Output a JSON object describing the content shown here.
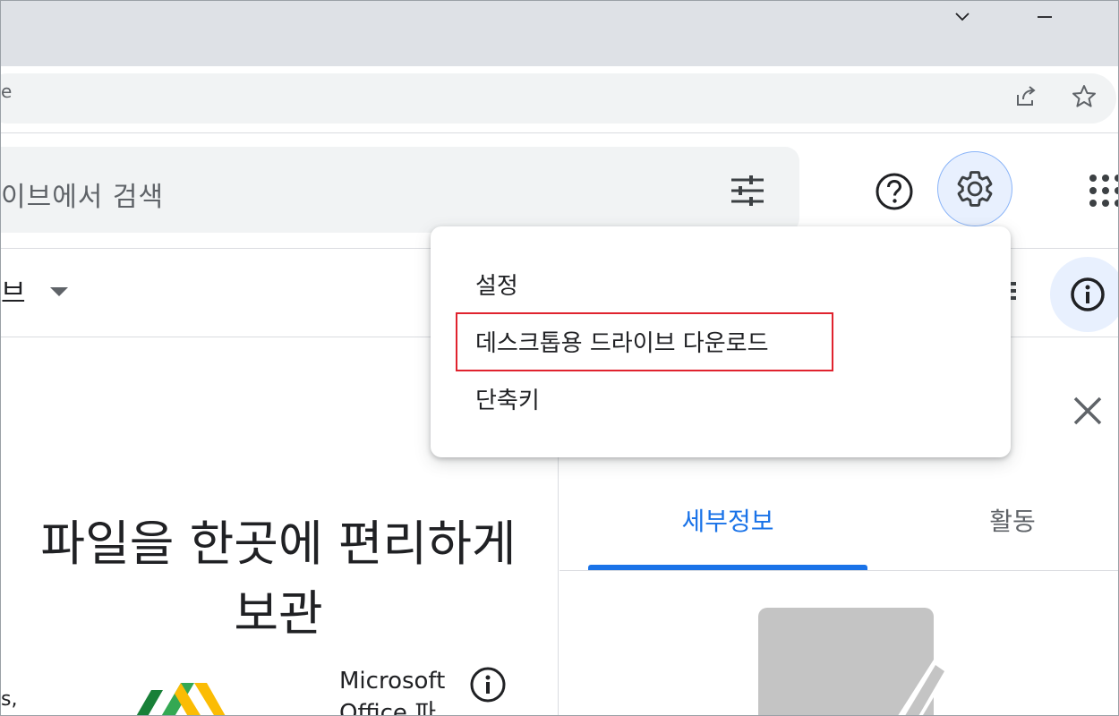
{
  "browser": {
    "omnibox_fragment": "e",
    "icons": [
      "chevron-down-icon",
      "minimize-icon",
      "share-icon",
      "star-icon"
    ]
  },
  "drive": {
    "search_placeholder": "이브에서 검색",
    "drive_label": "브",
    "icons": [
      "tune-icon",
      "help-icon",
      "gear-icon",
      "apps-grid-icon",
      "info-icon",
      "close-icon"
    ]
  },
  "settings_menu": {
    "items": [
      {
        "label": "설정"
      },
      {
        "label": "데스크톱용 드라이브 다운로드",
        "highlighted": true
      },
      {
        "label": "단축키"
      }
    ],
    "highlight_color": "#e0232e"
  },
  "main": {
    "hero_title_line1": "파일을 한곳에 편리하게",
    "hero_title_line2": "보관",
    "left_snippet": "s,",
    "ms_office_text": "Microsoft Office 파"
  },
  "details_panel": {
    "tabs": [
      {
        "label": "세부정보",
        "active": true
      },
      {
        "label": "활동",
        "active": false
      }
    ],
    "accent_color": "#1a73e8"
  }
}
